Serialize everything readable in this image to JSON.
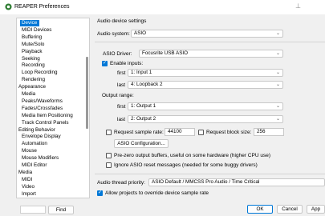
{
  "window": {
    "title": "REAPER Preferences",
    "pin_icon": "pin-icon"
  },
  "tree": {
    "items": [
      {
        "label": "Device",
        "indent": 1,
        "selected": true
      },
      {
        "label": "MIDI Devices",
        "indent": 1
      },
      {
        "label": "Buffering",
        "indent": 1
      },
      {
        "label": "Mute/Solo",
        "indent": 1
      },
      {
        "label": "Playback",
        "indent": 1
      },
      {
        "label": "Seeking",
        "indent": 1
      },
      {
        "label": "Recording",
        "indent": 1
      },
      {
        "label": "Loop Recording",
        "indent": 1
      },
      {
        "label": "Rendering",
        "indent": 1
      },
      {
        "label": "Appearance",
        "indent": 0
      },
      {
        "label": "Media",
        "indent": 1
      },
      {
        "label": "Peaks/Waveforms",
        "indent": 1
      },
      {
        "label": "Fades/Crossfades",
        "indent": 1
      },
      {
        "label": "Media Item Positioning",
        "indent": 1
      },
      {
        "label": "Track Control Panels",
        "indent": 1
      },
      {
        "label": "Editing Behavior",
        "indent": 0
      },
      {
        "label": "Envelope Display",
        "indent": 1
      },
      {
        "label": "Automation",
        "indent": 1
      },
      {
        "label": "Mouse",
        "indent": 1
      },
      {
        "label": "Mouse Modifiers",
        "indent": 1
      },
      {
        "label": "MIDI Editor",
        "indent": 1
      },
      {
        "label": "Media",
        "indent": 0
      },
      {
        "label": "MIDI",
        "indent": 1
      },
      {
        "label": "Video",
        "indent": 1
      },
      {
        "label": "Import",
        "indent": 1
      }
    ]
  },
  "find_button": "Find",
  "panel": {
    "title": "Audio device settings",
    "audio_system_label": "Audio system:",
    "audio_system_value": "ASIO",
    "asio_driver_label": "ASIO Driver:",
    "asio_driver_value": "Focusrite USB ASIO",
    "enable_inputs_label": "Enable inputs:",
    "enable_inputs_checked": true,
    "input_first_label": "first",
    "input_first_value": "1: Input 1",
    "input_last_label": "last",
    "input_last_value": "4: Loopback 2",
    "output_range_label": "Output range:",
    "output_first_label": "first",
    "output_first_value": "1: Output 1",
    "output_last_label": "last",
    "output_last_value": "2: Output 2",
    "request_rate_label": "Request sample rate:",
    "request_rate_value": "44100",
    "request_block_label": "Request block size:",
    "request_block_value": "256",
    "asio_config_button": "ASIO Configuration...",
    "prezero_label": "Pre-zero output buffers, useful on some hardware (higher CPU use)",
    "ignore_reset_label": "Ignore ASIO reset messages (needed for some buggy drivers)",
    "thread_priority_label": "Audio thread priority:",
    "thread_priority_value": "ASIO Default / MMCSS Pro Audio / Time Critical",
    "allow_override_label": "Allow projects to override device sample rate",
    "allow_override_checked": true
  },
  "footer": {
    "ok": "OK",
    "cancel": "Cancel",
    "apply": "App"
  },
  "colors": {
    "accent": "#0078d7",
    "title_icon": "#2e7d32"
  }
}
